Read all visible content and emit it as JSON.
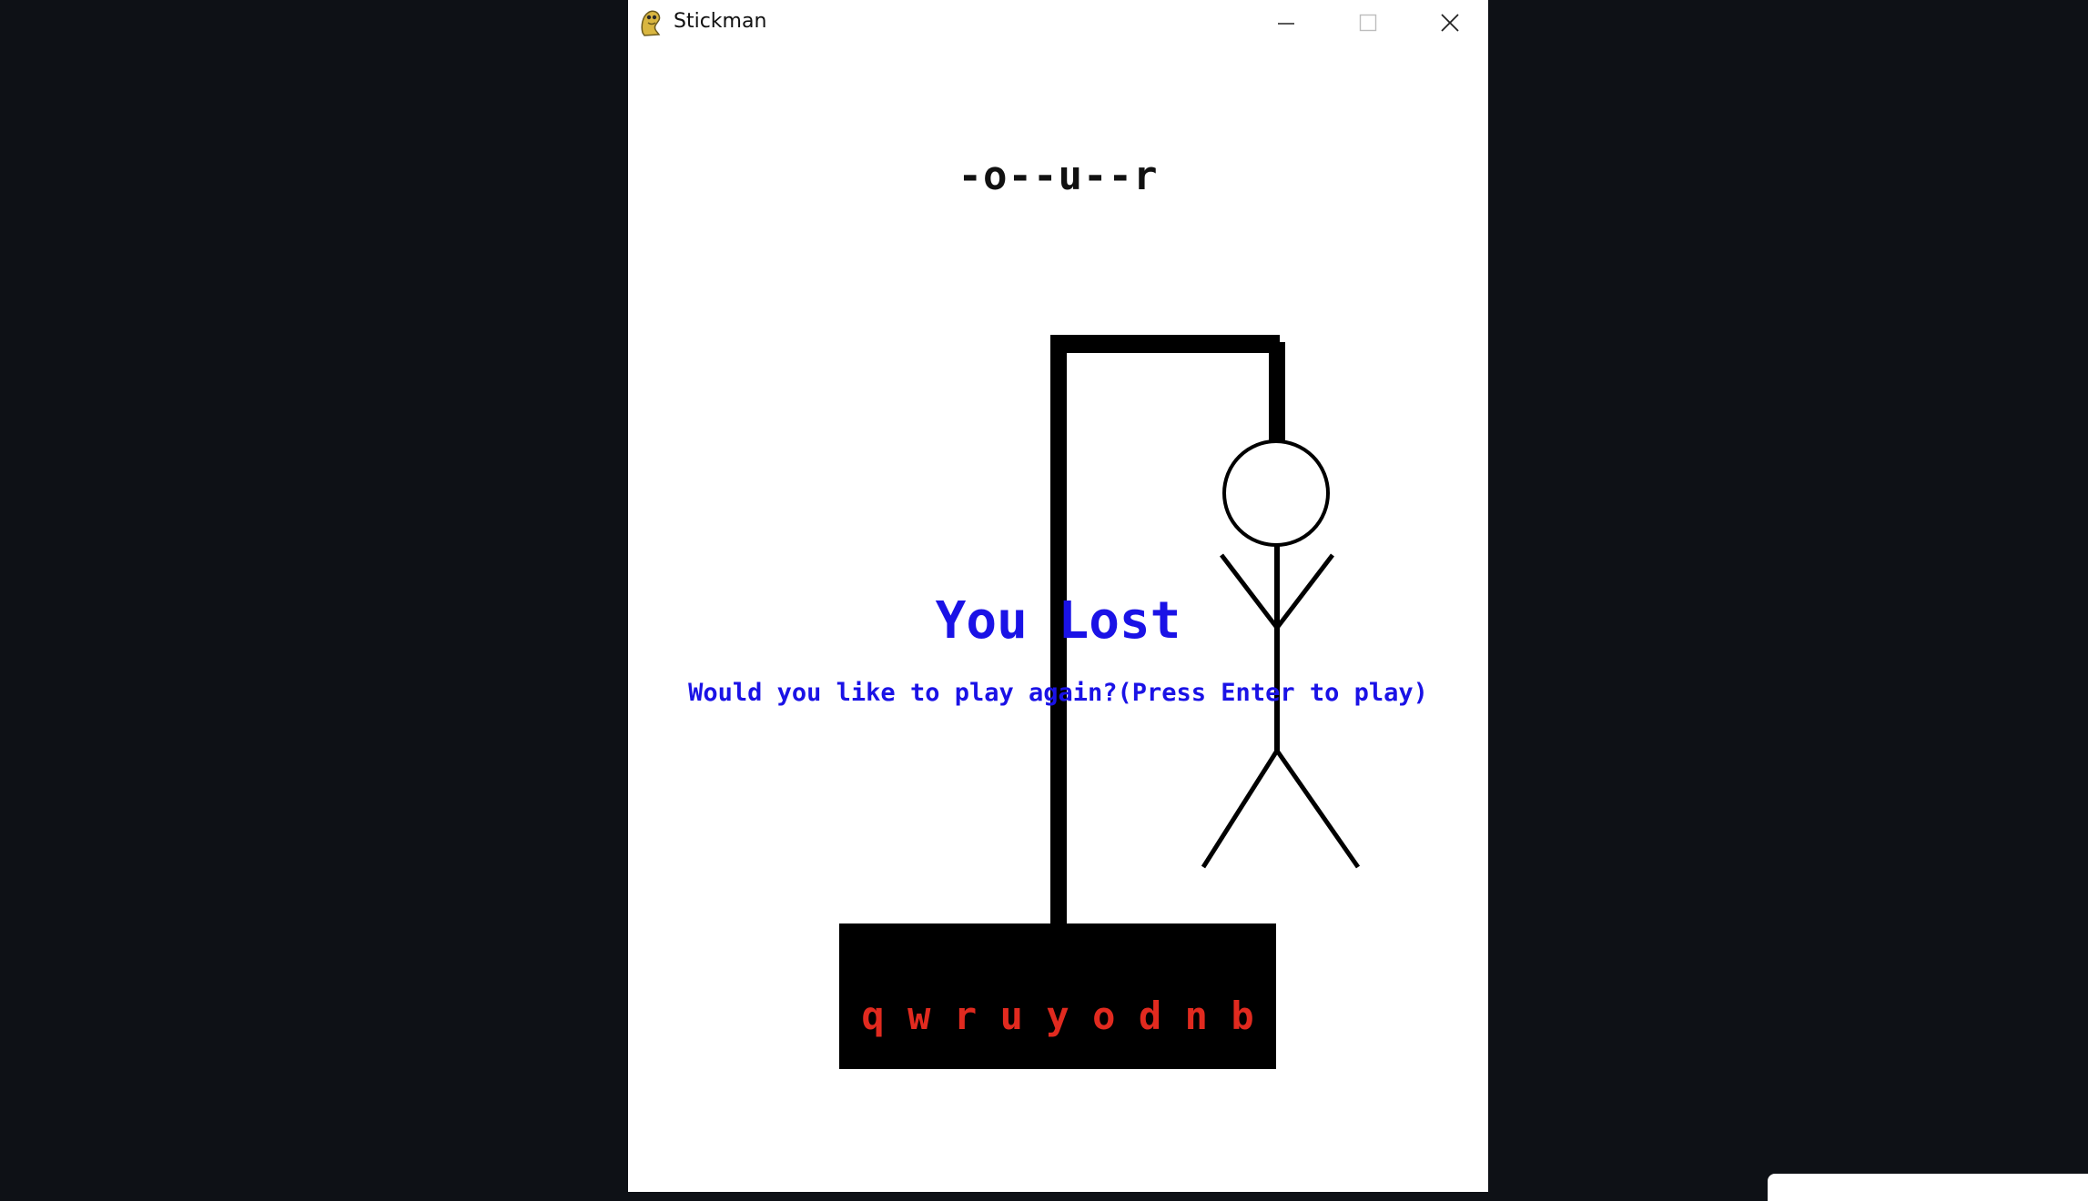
{
  "window": {
    "title": "Stickman",
    "icon": "pygame-snake-icon",
    "controls": {
      "minimize_icon": "minimize-icon",
      "maximize_icon": "maximize-icon",
      "close_icon": "close-icon"
    }
  },
  "game": {
    "masked_word": "-o--u--r",
    "guessed_letters": [
      "q",
      "w",
      "r",
      "u",
      "y",
      "o",
      "d",
      "n",
      "b"
    ],
    "result_title": "You Lost",
    "result_prompt": "Would you like to play again?(Press Enter to play)",
    "colors": {
      "result_text": "#1a12e6",
      "guessed_letters": "#e12a1f",
      "gallows": "#000000",
      "background": "#ffffff"
    }
  }
}
